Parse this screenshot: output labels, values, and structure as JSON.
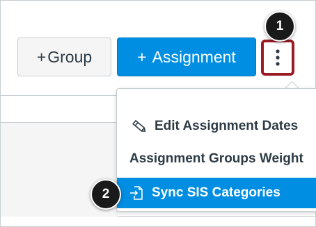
{
  "toolbar": {
    "group_button": {
      "plus": "+",
      "label": "Group"
    },
    "assignment_button": {
      "plus": "+",
      "label": "Assignment"
    },
    "options_button": {
      "icon": "kebab-vertical-icon"
    }
  },
  "steps": [
    {
      "number": "1"
    },
    {
      "number": "2"
    }
  ],
  "menu": {
    "items": [
      {
        "label": "Edit Assignment Dates",
        "icon": "pencil-icon"
      },
      {
        "label": "Assignment Groups Weight"
      },
      {
        "label": "Sync SIS Categories",
        "icon": "sync-import-icon",
        "highlighted": true
      }
    ]
  },
  "colors": {
    "primary": "#008ee2",
    "highlight_border": "#9b1b24",
    "text": "#2d3b45",
    "badge": "#1a1a1a"
  }
}
